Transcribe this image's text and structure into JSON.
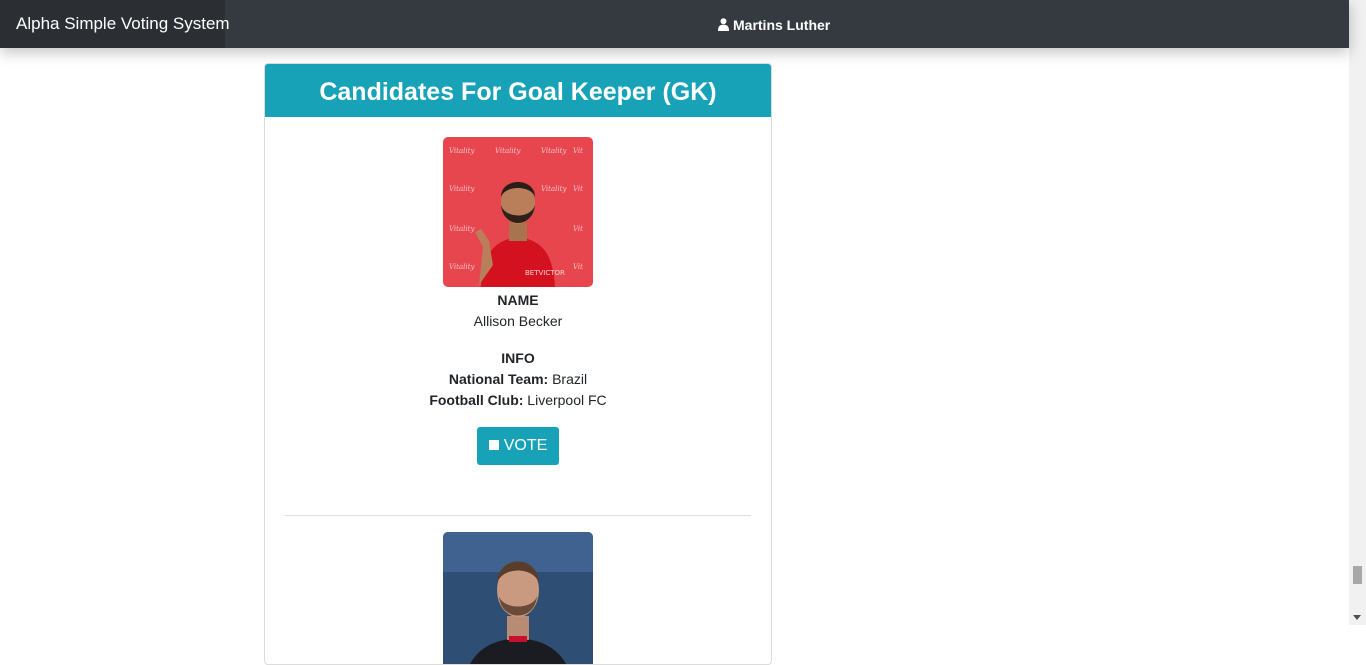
{
  "app": {
    "brand": "Alpha Simple Voting System",
    "user_name": "Martins Luther"
  },
  "section": {
    "title": "Candidates For Goal Keeper (GK)"
  },
  "candidates": [
    {
      "name_label": "NAME",
      "name": "Allison Becker",
      "info_label": "INFO",
      "national_team_label": "National Team:",
      "national_team": "Brazil",
      "club_label": "Football Club:",
      "club": "Liverpool FC",
      "vote_label": "VOTE",
      "photo_icon": "portrait-photo-red-backdrop"
    },
    {
      "photo_icon": "portrait-photo-blue-backdrop"
    }
  ],
  "colors": {
    "navbar": "#343a40",
    "brand_bg": "#2b2f34",
    "accent": "#17a2b8"
  },
  "icons": {
    "user": "user-icon",
    "vote_checkbox": "checkbox-icon"
  }
}
